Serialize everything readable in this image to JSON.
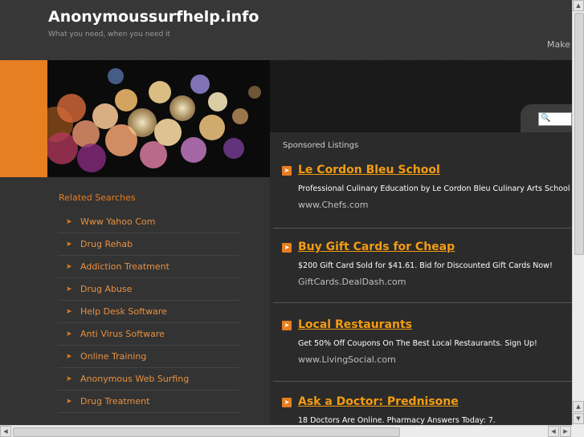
{
  "header": {
    "title": "Anonymoussurfhelp.info",
    "tagline": "What you need, when you need it",
    "make_link": "Make"
  },
  "search": {
    "placeholder": "",
    "icon": "search-icon"
  },
  "related": {
    "title": "Related Searches",
    "items": [
      {
        "label": "Www Yahoo Com"
      },
      {
        "label": "Drug Rehab"
      },
      {
        "label": "Addiction Treatment"
      },
      {
        "label": "Drug Abuse"
      },
      {
        "label": "Help Desk Software"
      },
      {
        "label": "Anti Virus Software"
      },
      {
        "label": "Online Training"
      },
      {
        "label": "Anonymous Web Surfing"
      },
      {
        "label": "Drug Treatment"
      }
    ]
  },
  "sponsored": {
    "heading": "Sponsored Listings",
    "listings": [
      {
        "title": "Le Cordon Bleu School",
        "desc": "Professional Culinary Education by Le Cordon Bleu Culinary Arts School",
        "url": "www.Chefs.com"
      },
      {
        "title": "Buy Gift Cards for Cheap",
        "desc": "$200 Gift Card Sold for $41.61. Bid for Discounted Gift Cards Now!",
        "url": "GiftCards.DealDash.com"
      },
      {
        "title": "Local Restaurants",
        "desc": "Get 50% Off Coupons On The Best Local Restaurants. Sign Up!",
        "url": "www.LivingSocial.com"
      },
      {
        "title": "Ask a Doctor: Prednisone",
        "desc": "18 Doctors Are Online. Pharmacy Answers Today: 7.",
        "url": ""
      }
    ]
  },
  "colors": {
    "accent": "#e67e22",
    "link": "#f39c12",
    "background": "#2f2f2f"
  }
}
